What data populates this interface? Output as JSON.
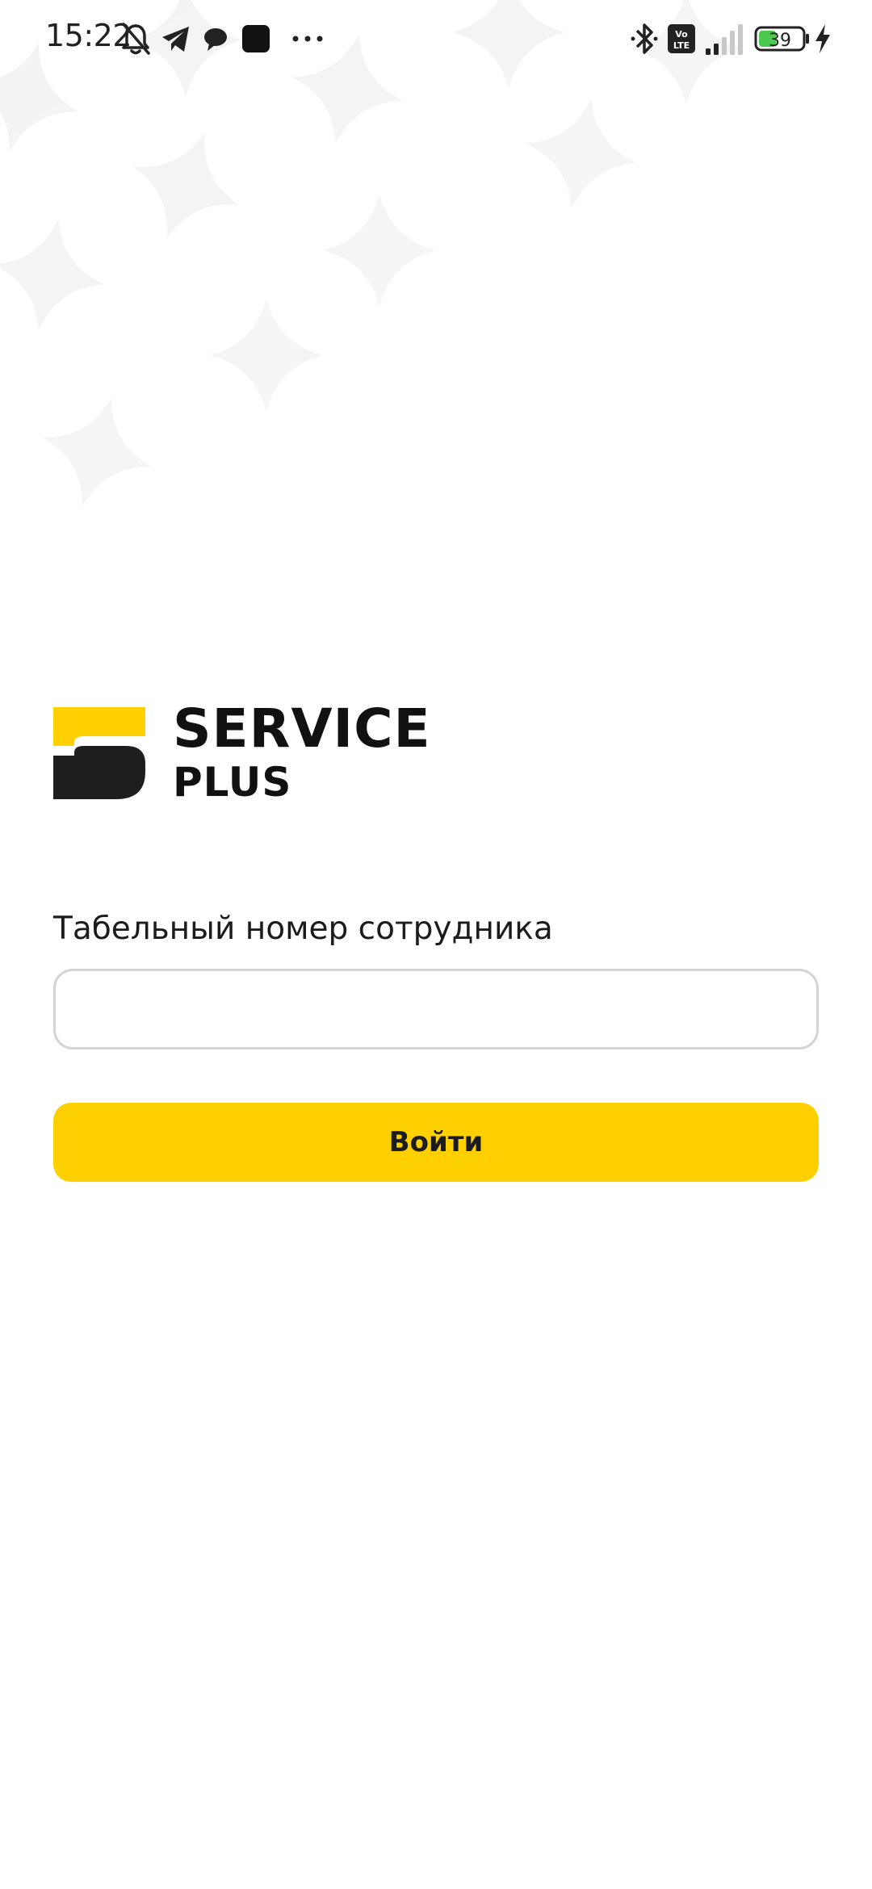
{
  "status_bar": {
    "time": "15:22",
    "battery_level": "39",
    "icons": [
      "notifications-muted-icon",
      "telegram-icon",
      "chat-icon",
      "app-icon",
      "more-icon",
      "bluetooth-icon",
      "volte-icon",
      "signal-icon",
      "battery-icon",
      "charging-icon"
    ],
    "volte_label_top": "Vo",
    "volte_label_bottom": "LTE"
  },
  "brand": {
    "name_line1": "SERVICE",
    "name_line2": "PLUS",
    "accent_color": "#FFD000",
    "dark_color": "#1E1E1E"
  },
  "login_form": {
    "employee_number_label": "Табельный номер сотрудника",
    "employee_number_value": "",
    "employee_number_placeholder": "",
    "submit_label": "Войти"
  }
}
